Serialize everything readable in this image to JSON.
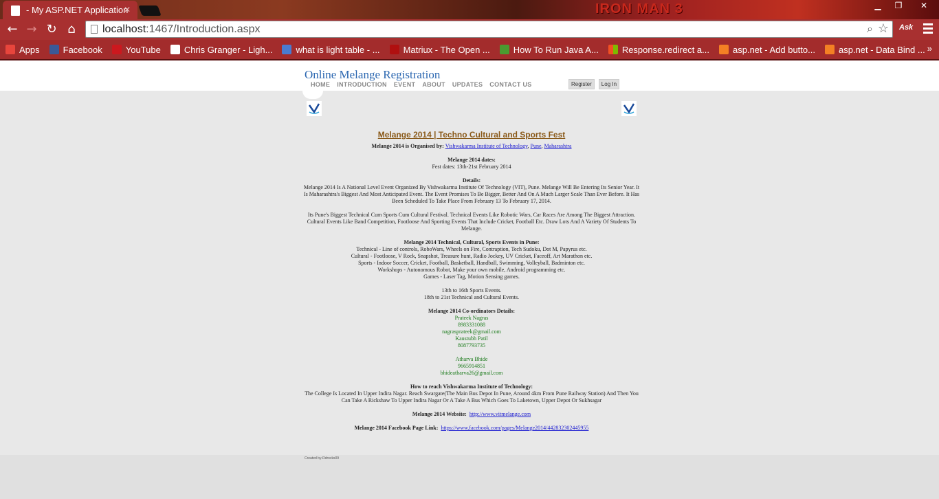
{
  "browser": {
    "tab_title": "- My ASP.NET Application",
    "banner_text": "IRON MAN 3",
    "url_host": "localhost",
    "url_path": ":1467/Introduction.aspx",
    "ask_label": "Ask",
    "bookmarks": [
      {
        "label": "Apps",
        "icon": "apps-grid-icon",
        "color": "#e8453c"
      },
      {
        "label": "Facebook",
        "icon": "facebook-icon",
        "color": "#3b5998"
      },
      {
        "label": "YouTube",
        "icon": "youtube-icon",
        "color": "#cc181e"
      },
      {
        "label": "Chris Granger - Ligh...",
        "icon": "page-icon",
        "color": "#ffffff"
      },
      {
        "label": "what is light table - ...",
        "icon": "google-icon",
        "color": "#4a7bd0"
      },
      {
        "label": "Matriux - The Open ...",
        "icon": "matriux-icon",
        "color": "#b01010"
      },
      {
        "label": "How To Run Java A...",
        "icon": "java-icon",
        "color": "#4a9a30"
      },
      {
        "label": "Response.redirect a...",
        "icon": "microsoft-icon",
        "color": "#f25022"
      },
      {
        "label": "asp.net - Add butto...",
        "icon": "stackoverflow-icon",
        "color": "#f48024"
      },
      {
        "label": "asp.net - Data Bind ...",
        "icon": "stackoverflow-icon",
        "color": "#f48024"
      }
    ],
    "bookmarks_more": "»"
  },
  "site": {
    "title": "Online Melange Registration",
    "nav": [
      "HOME",
      "INTRODUCTION",
      "EVENT",
      "ABOUT",
      "UPDATES",
      "CONTACT US"
    ],
    "register": "Register",
    "login": "Log In"
  },
  "content": {
    "heading": "Melange 2014 | Techno Cultural and Sports Fest",
    "organised_label": "Melange 2014 is Organised by:",
    "org_link": "Vishwakarma Institute of Technology",
    "city_link": "Pune",
    "state_link": "Maharashtra",
    "dates_label": "Melange 2014 dates:",
    "dates_value": "Fest dates: 13th-21st February 2014",
    "details_label": "Details:",
    "details_p1": "Melange 2014 Is A National Level Event Organized By Vishwakarma Institute Of Technology (VIT), Pune. Melange Will Be Entering Its Senior Year. It Is Maharashtra's Biggest And Most Anticipated Event. The Event Promises To Be Bigger, Better And On A Much Larger Scale Than Ever Before. It Has Been Scheduled To Take Place From February 13 To February 17, 2014.",
    "details_p2": "Its Pune's Biggest Technical Cum Sports Cum Cultural Festival. Technical Events Like Robotic Wars, Car Races Are Among The Biggest Attraction. Cultural Events Like Band Competition, Footloose And Sporting Events That Include Cricket, Football Etc. Draw Lots And A Variety Of Students To Melange.",
    "events_label": "Melange 2014 Technical, Cultural, Sports Events in Pune:",
    "events": [
      "Technical - Line of controls, RoboWars, Wheels on Fire, Contraption, Tech Sudoku, Dot M, Papyrus etc.",
      "Cultural - Footloose, V Rock, Snapshot, Treasure hunt, Radio Jockey, UV Cricket, Faceoff, Art Marathon etc.",
      "Sports - Indoor Soccer, Cricket, Football, Basketball, Handball, Swimming, Volleyball, Badminton etc.",
      "Workshops - Autonomous Robot, Make your own mobile, Android programming etc.",
      "Games - Laser Tag, Motion Sensing games."
    ],
    "schedule": [
      "13th to 16th Sports Events.",
      "18th to 21st Technical and Cultural Events."
    ],
    "coordinators_label": "Melange 2014 Co-ordinators Details:",
    "coord1": [
      "Prateek Nagras",
      "8983331088",
      "nagrasprateek@gmail.com",
      "Kaustubh Patil",
      "8087793735"
    ],
    "coord2": [
      "Atharva Bhide",
      "9665914851",
      "bhideatharva26@gmail.com"
    ],
    "reach_label": "How to reach Vishwakarma Institute of Technology:",
    "reach_text": "The College Is Located In Upper Indira Nagar. Reach Swargate(The Main Bus Depot In Pune, Around 4km From Pune Railway Station) And Then You Can Take A Rickshaw To Upper Indira Nagar Or A Take A Bus Which Goes To Laketown, Upper Depot Or Sukhsagar",
    "website_label": "Melange 2014 Website:",
    "website_link": "http://www.vitmelange.com",
    "fb_label": "Melange 2014 Facebook Page Link:",
    "fb_link": "https://www.facebook.com/pages/Melange2014/442832302445955"
  },
  "footer": {
    "created": "Created by-Rdrocks09"
  }
}
